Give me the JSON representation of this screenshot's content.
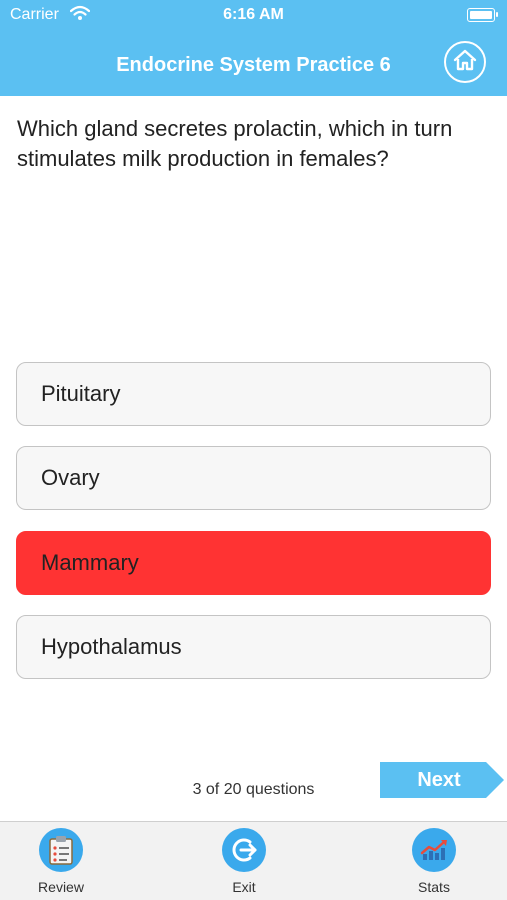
{
  "status": {
    "carrier": "Carrier",
    "time": "6:16 AM"
  },
  "nav": {
    "title": "Endocrine System Practice 6"
  },
  "question": "Which gland secretes prolactin, which in turn stimulates milk production in females?",
  "answers": [
    {
      "label": "Pituitary",
      "state": "default"
    },
    {
      "label": "Ovary",
      "state": "default"
    },
    {
      "label": "Mammary",
      "state": "incorrect-selected"
    },
    {
      "label": "Hypothalamus",
      "state": "default"
    }
  ],
  "progress": {
    "text": "3 of 20 questions",
    "current": 3,
    "total": 20
  },
  "next_label": "Next",
  "tabs": [
    {
      "label": "Review",
      "icon": "clipboard-icon"
    },
    {
      "label": "Exit",
      "icon": "exit-icon"
    },
    {
      "label": "Stats",
      "icon": "stats-chart-icon"
    }
  ],
  "colors": {
    "header": "#5bc0f2",
    "incorrect": "#ff3333",
    "tab_icon": "#3aa9ec",
    "next_button": "#5bc0f2"
  }
}
